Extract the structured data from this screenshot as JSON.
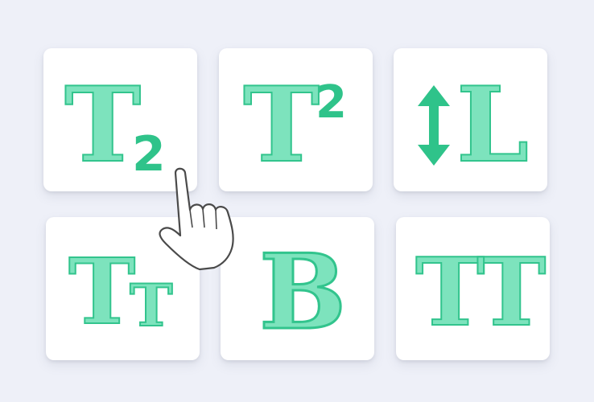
{
  "tiles": {
    "subscript": {
      "main": "T",
      "sub": "2",
      "icon": "subscript-icon"
    },
    "superscript": {
      "main": "T",
      "sup": "2",
      "icon": "superscript-icon"
    },
    "line_height": {
      "letter": "L",
      "icon": "line-height-icon"
    },
    "small_caps": {
      "big": "T",
      "small": "T",
      "icon": "small-caps-icon"
    },
    "bold": {
      "letter": "B",
      "icon": "bold-icon"
    },
    "all_caps": {
      "letters": "TT",
      "icon": "all-caps-icon"
    }
  },
  "cursor": {
    "icon": "hand-pointer-icon"
  },
  "colors": {
    "background": "#eef0f8",
    "tile": "#ffffff",
    "accent_fill": "#7de3bd",
    "accent_stroke": "#32c48d"
  }
}
